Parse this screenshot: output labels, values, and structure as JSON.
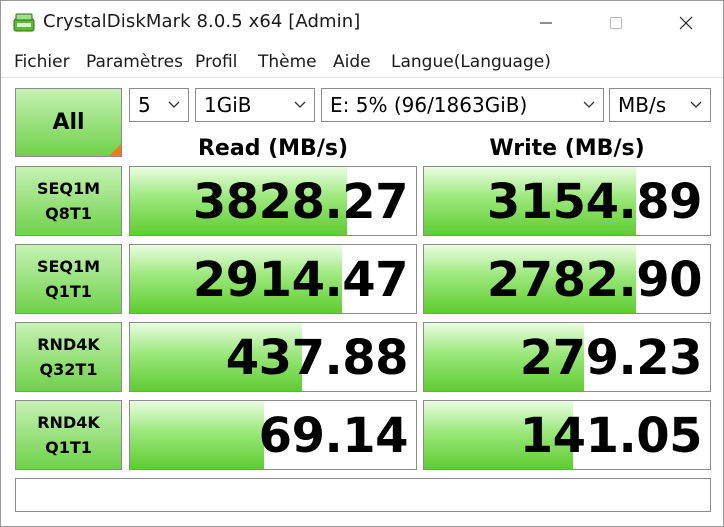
{
  "window": {
    "title": "CrystalDiskMark 8.0.5 x64 [Admin]",
    "icon": "app-disk-icon"
  },
  "menu": [
    "Fichier",
    "Paramètres",
    "Profil",
    "Thème",
    "Aide",
    "Langue(Language)"
  ],
  "controls": {
    "all_label": "All",
    "count": "5",
    "size": "1GiB",
    "drive": "E: 5% (96/1863GiB)",
    "unit": "MB/s"
  },
  "columns": {
    "read": "Read (MB/s)",
    "write": "Write (MB/s)"
  },
  "tests": [
    {
      "line1": "SEQ1M",
      "line2": "Q8T1",
      "read": "3828.27",
      "write": "3154.89",
      "read_fill": 0.76,
      "write_fill": 0.74
    },
    {
      "line1": "SEQ1M",
      "line2": "Q1T1",
      "read": "2914.47",
      "write": "2782.90",
      "read_fill": 0.74,
      "write_fill": 0.74
    },
    {
      "line1": "RND4K",
      "line2": "Q32T1",
      "read": "437.88",
      "write": "279.23",
      "read_fill": 0.6,
      "write_fill": 0.56
    },
    {
      "line1": "RND4K",
      "line2": "Q1T1",
      "read": "69.14",
      "write": "141.05",
      "read_fill": 0.47,
      "write_fill": 0.52
    }
  ],
  "comment": "",
  "colors": {
    "accent_green": "#6fd14a",
    "accent_orange": "#f07a1a"
  }
}
